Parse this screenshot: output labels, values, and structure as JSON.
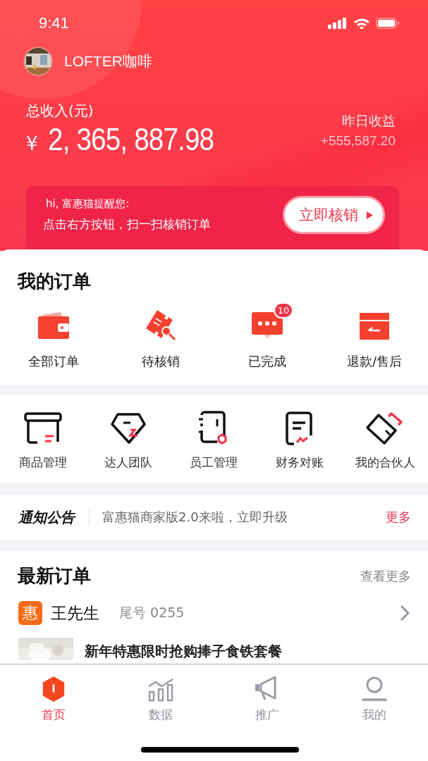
{
  "status_bar": {
    "time": "9:41"
  },
  "shop": {
    "name": "LOFTER咖啡"
  },
  "income": {
    "label": "总收入(元)",
    "currency": "¥",
    "amount": "2, 365, 887.98",
    "yesterday_label": "昨日收益",
    "yesterday_value": "+555,587.20"
  },
  "reminder": {
    "greeting": "hi, 富惠猫提醒您:",
    "message": "点击右方按钮，扫一扫核销订单",
    "button": "立即核销"
  },
  "my_orders": {
    "title": "我的订单",
    "items": [
      {
        "kind": "wallet",
        "label": "全部订单"
      },
      {
        "kind": "ticket",
        "label": "待核销"
      },
      {
        "kind": "message",
        "label": "已完成",
        "badge": "10"
      },
      {
        "kind": "box",
        "label": "退款/售后"
      }
    ]
  },
  "tools": [
    {
      "kind": "shelf",
      "label": "商品管理"
    },
    {
      "kind": "tag",
      "label": "达人团队"
    },
    {
      "kind": "notebook",
      "label": "员工管理"
    },
    {
      "kind": "document",
      "label": "财务对账"
    },
    {
      "kind": "cards",
      "label": "我的合伙人"
    }
  ],
  "notice": {
    "title": "通知公告",
    "text": "富惠猫商家版2.0来啦，立即升级",
    "more": "更多"
  },
  "latest_orders": {
    "title": "最新订单",
    "more": "查看更多",
    "orders": [
      {
        "tag": "惠",
        "customer": "王先生",
        "tail": "尾号 0255",
        "product": "新年特惠限时抢购捧子食铁套餐"
      }
    ]
  },
  "tab_bar": [
    {
      "kind": "home",
      "label": "首页",
      "selected": true
    },
    {
      "kind": "chart",
      "label": "数据",
      "selected": false
    },
    {
      "kind": "megaphone",
      "label": "推广",
      "selected": false
    },
    {
      "kind": "person",
      "label": "我的",
      "selected": false
    }
  ]
}
